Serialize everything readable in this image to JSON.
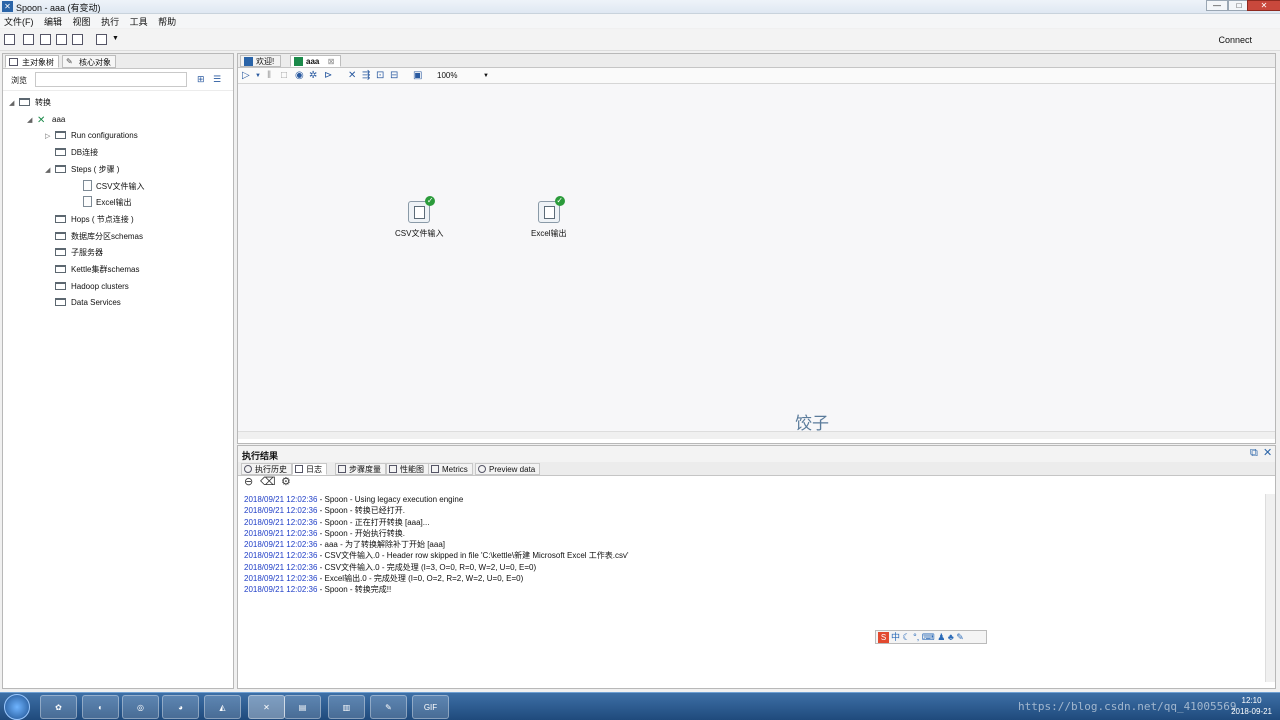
{
  "window": {
    "title": "Spoon - aaa (有变动)",
    "minimize": "—",
    "maximize": "□",
    "close": "✕"
  },
  "menu": [
    "文件(F)",
    "编辑",
    "视图",
    "执行",
    "工具",
    "帮助"
  ],
  "toolbar": {
    "connect_label": "Connect"
  },
  "left_panel": {
    "tabs": [
      {
        "label": "主对象树",
        "active": true
      },
      {
        "label": "核心对象",
        "active": false
      }
    ],
    "browse_label": "浏览",
    "search_value": "",
    "tree": [
      {
        "label": "转换",
        "arrow": "◢",
        "icon": "folder"
      },
      {
        "label": "aaa",
        "arrow": "◢",
        "icon": "transformation"
      },
      {
        "label": "Run configurations",
        "arrow": "▷",
        "icon": "folder"
      },
      {
        "label": "DB连接",
        "arrow": "",
        "icon": "folder"
      },
      {
        "label": "Steps ( 步骤 )",
        "arrow": "◢",
        "icon": "folder"
      },
      {
        "label": "CSV文件输入",
        "arrow": "",
        "icon": "file"
      },
      {
        "label": "Excel输出",
        "arrow": "",
        "icon": "file"
      },
      {
        "label": "Hops ( 节点连接 )",
        "arrow": "",
        "icon": "folder"
      },
      {
        "label": "数据库分区schemas",
        "arrow": "",
        "icon": "folder"
      },
      {
        "label": "子服务器",
        "arrow": "",
        "icon": "folder"
      },
      {
        "label": "Kettle集群schemas",
        "arrow": "",
        "icon": "folder"
      },
      {
        "label": "Hadoop clusters",
        "arrow": "",
        "icon": "folder"
      },
      {
        "label": "Data Services",
        "arrow": "",
        "icon": "folder"
      }
    ]
  },
  "editor": {
    "tabs": [
      {
        "label": "欢迎!",
        "active": false
      },
      {
        "label": "aaa",
        "active": true,
        "close": "⊠"
      }
    ],
    "zoom": "100%",
    "steps": [
      {
        "label": "CSV文件输入",
        "status": "ok"
      },
      {
        "label": "Excel输出",
        "status": "ok"
      }
    ],
    "canvas_text": "饺子"
  },
  "results": {
    "title": "执行结果",
    "tabs": [
      {
        "label": "执行历史",
        "active": false
      },
      {
        "label": "日志",
        "active": true
      },
      {
        "label": "步骤度量",
        "active": false
      },
      {
        "label": "性能图",
        "active": false
      },
      {
        "label": "Metrics",
        "active": false
      },
      {
        "label": "Preview data",
        "active": false
      }
    ],
    "log": [
      {
        "ts": "2018/09/21 12:02:36",
        "msg": " - Spoon - Using legacy execution engine"
      },
      {
        "ts": "2018/09/21 12:02:36",
        "msg": " - Spoon - 转换已经打开."
      },
      {
        "ts": "2018/09/21 12:02:36",
        "msg": " - Spoon - 正在打开转换 [aaa]..."
      },
      {
        "ts": "2018/09/21 12:02:36",
        "msg": " - Spoon - 开始执行转换."
      },
      {
        "ts": "2018/09/21 12:02:36",
        "msg": " - aaa - 为了转换解除补丁开始  [aaa]"
      },
      {
        "ts": "2018/09/21 12:02:36",
        "msg": " - CSV文件输入.0 - Header row skipped in file 'C:\\kettle\\新建 Microsoft Excel 工作表.csv'"
      },
      {
        "ts": "2018/09/21 12:02:36",
        "msg": " - CSV文件输入.0 - 完成处理 (I=3, O=0, R=0, W=2, U=0, E=0)"
      },
      {
        "ts": "2018/09/21 12:02:36",
        "msg": " - Excel输出.0 - 完成处理 (I=0, O=2, R=2, W=2, U=0, E=0)"
      },
      {
        "ts": "2018/09/21 12:02:36",
        "msg": " - Spoon - 转换完成!!"
      }
    ],
    "ime_bar": {
      "logo": "S",
      "mode": "中"
    }
  },
  "taskbar": {
    "apps": [
      "start",
      "app-1",
      "chrome",
      "app-3",
      "app-4",
      "kettle",
      "explorer",
      "app-7",
      "app-8",
      "gif-recorder"
    ],
    "gif_label": "GIF",
    "clock_time": "12:10",
    "clock_date": "2018-09-21"
  },
  "watermark": "https://blog.csdn.net/qq_41005569"
}
